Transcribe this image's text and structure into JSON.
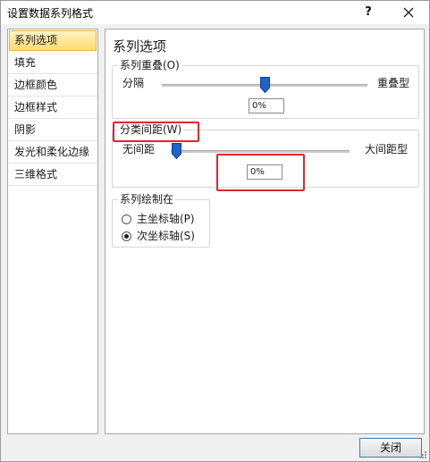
{
  "window": {
    "title": "设置数据系列格式",
    "help_label": "?"
  },
  "nav": {
    "items": [
      {
        "label": "系列选项",
        "selected": true
      },
      {
        "label": "填充",
        "selected": false
      },
      {
        "label": "边框颜色",
        "selected": false
      },
      {
        "label": "边框样式",
        "selected": false
      },
      {
        "label": "阴影",
        "selected": false
      },
      {
        "label": "发光和柔化边缘",
        "selected": false
      },
      {
        "label": "三维格式",
        "selected": false
      }
    ]
  },
  "content": {
    "section_title": "系列选项",
    "overlap": {
      "label": "系列重叠(O)",
      "left_label": "分隔",
      "right_label": "重叠型",
      "value": "0%",
      "level_fraction": 0.5
    },
    "gap_width": {
      "label": "分类间距(W)",
      "left_label": "无间距",
      "right_label": "大间距型",
      "value": "0%",
      "level_fraction": 0.0
    },
    "plot_on": {
      "label": "系列绘制在",
      "options": [
        {
          "label": "主坐标轴(P)",
          "checked": false
        },
        {
          "label": "次坐标轴(S)",
          "checked": true
        }
      ]
    }
  },
  "footer": {
    "close_label": "关闭"
  },
  "colors": {
    "highlight_red": "#e0262e",
    "thumb_blue": "#1e64c8",
    "selected_nav_bg": "#ffdb6e"
  }
}
